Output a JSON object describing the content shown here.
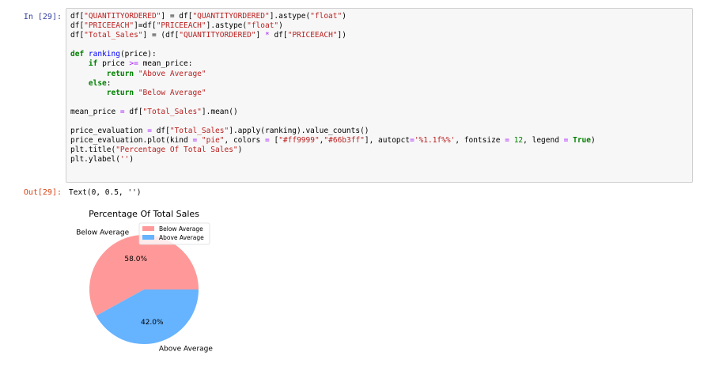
{
  "cell": {
    "in_prompt": "In [29]:",
    "out_prompt": "Out[29]:",
    "output_text": "Text(0, 0.5, '')"
  },
  "code": [
    [
      [
        "df[",
        ""
      ],
      [
        "\"QUANTITYORDERED\"",
        "s"
      ],
      [
        "] = df[",
        ""
      ],
      [
        "\"QUANTITYORDERED\"",
        "s"
      ],
      [
        "].astype(",
        ""
      ],
      [
        "\"float\"",
        "s"
      ],
      [
        ")",
        ""
      ]
    ],
    [
      [
        "df[",
        ""
      ],
      [
        "\"PRICEEACH\"",
        "s"
      ],
      [
        "]=df[",
        ""
      ],
      [
        "\"PRICEEACH\"",
        "s"
      ],
      [
        "].astype(",
        ""
      ],
      [
        "\"float\"",
        "s"
      ],
      [
        ")",
        ""
      ]
    ],
    [
      [
        "df[",
        ""
      ],
      [
        "\"Total_Sales\"",
        "s"
      ],
      [
        "] = (df[",
        ""
      ],
      [
        "\"QUANTITYORDERED\"",
        "s"
      ],
      [
        "] ",
        ""
      ],
      [
        "*",
        "op"
      ],
      [
        " df[",
        ""
      ],
      [
        "\"PRICEEACH\"",
        "s"
      ],
      [
        "])",
        ""
      ]
    ],
    [],
    [
      [
        "def",
        "k"
      ],
      [
        " ",
        ""
      ],
      [
        "ranking",
        "fn"
      ],
      [
        "(price):",
        ""
      ]
    ],
    [
      [
        "    ",
        ""
      ],
      [
        "if",
        "k"
      ],
      [
        " price ",
        ""
      ],
      [
        ">=",
        "op"
      ],
      [
        " mean_price:",
        ""
      ]
    ],
    [
      [
        "        ",
        ""
      ],
      [
        "return",
        "k"
      ],
      [
        " ",
        ""
      ],
      [
        "\"Above Average\"",
        "s"
      ]
    ],
    [
      [
        "    ",
        ""
      ],
      [
        "else",
        "k"
      ],
      [
        ":",
        ""
      ]
    ],
    [
      [
        "        ",
        ""
      ],
      [
        "return",
        "k"
      ],
      [
        " ",
        ""
      ],
      [
        "\"Below Average\"",
        "s"
      ]
    ],
    [],
    [
      [
        "mean_price ",
        ""
      ],
      [
        "=",
        "op"
      ],
      [
        " df[",
        ""
      ],
      [
        "\"Total_Sales\"",
        "s"
      ],
      [
        "].mean()",
        ""
      ]
    ],
    [],
    [
      [
        "price_evaluation ",
        ""
      ],
      [
        "=",
        "op"
      ],
      [
        " df[",
        ""
      ],
      [
        "\"Total_Sales\"",
        "s"
      ],
      [
        "].apply(ranking).value_counts()",
        ""
      ]
    ],
    [
      [
        "price_evaluation.plot(kind ",
        ""
      ],
      [
        "=",
        "op"
      ],
      [
        " ",
        ""
      ],
      [
        "\"pie\"",
        "s"
      ],
      [
        ", colors ",
        ""
      ],
      [
        "=",
        "op"
      ],
      [
        " [",
        ""
      ],
      [
        "\"#ff9999\"",
        "s"
      ],
      [
        ",",
        ""
      ],
      [
        "\"#66b3ff\"",
        "s"
      ],
      [
        "], autopct",
        ""
      ],
      [
        "=",
        "op"
      ],
      [
        "'%1.1f%%'",
        "s"
      ],
      [
        ", fontsize ",
        ""
      ],
      [
        "=",
        "op"
      ],
      [
        " ",
        ""
      ],
      [
        "12",
        "num"
      ],
      [
        ", legend ",
        ""
      ],
      [
        "=",
        "op"
      ],
      [
        " ",
        ""
      ],
      [
        "True",
        "k"
      ],
      [
        ")",
        ""
      ]
    ],
    [
      [
        "plt.title(",
        ""
      ],
      [
        "\"Percentage Of Total Sales\"",
        "s"
      ],
      [
        ")",
        ""
      ]
    ],
    [
      [
        "plt.ylabel(",
        ""
      ],
      [
        "''",
        "s"
      ],
      [
        ")",
        ""
      ]
    ]
  ],
  "chart_data": {
    "type": "pie",
    "title": "Percentage Of Total Sales",
    "categories": [
      "Below Average",
      "Above Average"
    ],
    "values": [
      58.0,
      42.0
    ],
    "percent_labels": [
      "58.0%",
      "42.0%"
    ],
    "colors": [
      "#ff9999",
      "#66b3ff"
    ],
    "legend": {
      "entries": [
        "Below Average",
        "Above Average"
      ],
      "placement": "top-right"
    }
  }
}
